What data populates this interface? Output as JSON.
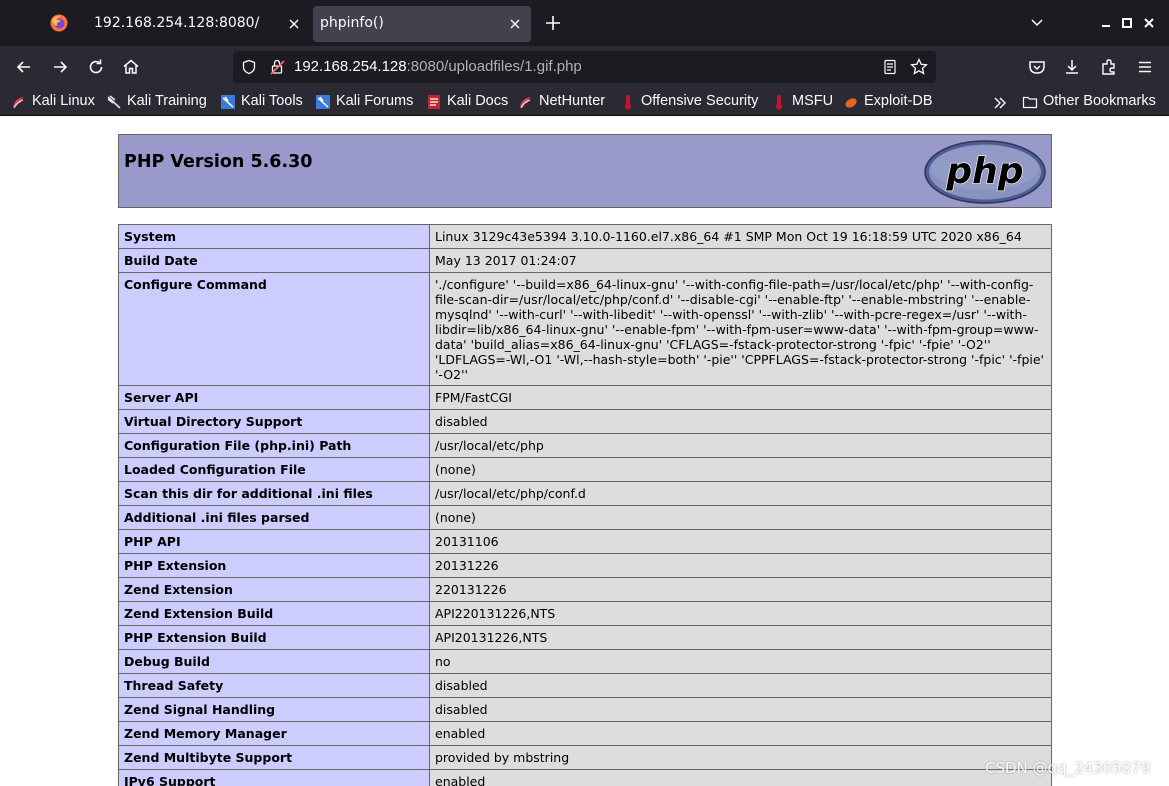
{
  "tabs": [
    {
      "title": "192.168.254.128:8080/"
    },
    {
      "title": "phpinfo()"
    }
  ],
  "address_bar": {
    "host": "192.168.254.128",
    "rest": ":8080/uploadfiles/1.gif.php"
  },
  "bookmarks": [
    {
      "label": "Kali Linux"
    },
    {
      "label": "Kali Training"
    },
    {
      "label": "Kali Tools"
    },
    {
      "label": "Kali Forums"
    },
    {
      "label": "Kali Docs"
    },
    {
      "label": "NetHunter"
    },
    {
      "label": "Offensive Security"
    },
    {
      "label": "MSFU"
    },
    {
      "label": "Exploit-DB"
    }
  ],
  "other_bookmarks": "Other Bookmarks",
  "php": {
    "title": "PHP Version 5.6.30",
    "logo_text": "php"
  },
  "info_rows": [
    {
      "k": "System",
      "v": "Linux 3129c43e5394 3.10.0-1160.el7.x86_64 #1 SMP Mon Oct 19 16:18:59 UTC 2020 x86_64"
    },
    {
      "k": "Build Date",
      "v": "May 13 2017 01:24:07"
    },
    {
      "k": "Configure Command",
      "v": "'./configure' '--build=x86_64-linux-gnu' '--with-config-file-path=/usr/local/etc/php' '--with-config-file-scan-dir=/usr/local/etc/php/conf.d' '--disable-cgi' '--enable-ftp' '--enable-mbstring' '--enable-mysqlnd' '--with-curl' '--with-libedit' '--with-openssl' '--with-zlib' '--with-pcre-regex=/usr' '--with-libdir=lib/x86_64-linux-gnu' '--enable-fpm' '--with-fpm-user=www-data' '--with-fpm-group=www-data' 'build_alias=x86_64-linux-gnu' 'CFLAGS=-fstack-protector-strong '-fpic' '-fpie' '-O2'' 'LDFLAGS=-Wl,-O1 '-Wl,--hash-style=both' '-pie'' 'CPPFLAGS=-fstack-protector-strong '-fpic' '-fpie' '-O2''"
    },
    {
      "k": "Server API",
      "v": "FPM/FastCGI"
    },
    {
      "k": "Virtual Directory Support",
      "v": "disabled"
    },
    {
      "k": "Configuration File (php.ini) Path",
      "v": "/usr/local/etc/php"
    },
    {
      "k": "Loaded Configuration File",
      "v": "(none)"
    },
    {
      "k": "Scan this dir for additional .ini files",
      "v": "/usr/local/etc/php/conf.d"
    },
    {
      "k": "Additional .ini files parsed",
      "v": "(none)"
    },
    {
      "k": "PHP API",
      "v": "20131106"
    },
    {
      "k": "PHP Extension",
      "v": "20131226"
    },
    {
      "k": "Zend Extension",
      "v": "220131226"
    },
    {
      "k": "Zend Extension Build",
      "v": "API220131226,NTS"
    },
    {
      "k": "PHP Extension Build",
      "v": "API20131226,NTS"
    },
    {
      "k": "Debug Build",
      "v": "no"
    },
    {
      "k": "Thread Safety",
      "v": "disabled"
    },
    {
      "k": "Zend Signal Handling",
      "v": "disabled"
    },
    {
      "k": "Zend Memory Manager",
      "v": "enabled"
    },
    {
      "k": "Zend Multibyte Support",
      "v": "provided by mbstring"
    },
    {
      "k": "IPv6 Support",
      "v": "enabled"
    }
  ],
  "watermark": "CSDN @qq_24305079",
  "colors": {
    "chrome_dark": "#1c1b22",
    "chrome_toolbar": "#2b2a33",
    "php_header": "#9999cc",
    "php_key_cell": "#ccccff",
    "php_value_cell": "#dddddd"
  }
}
